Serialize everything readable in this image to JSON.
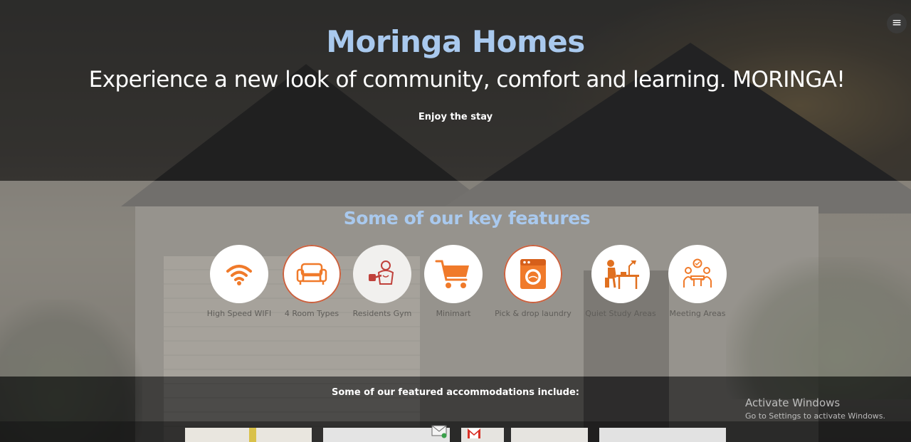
{
  "hero": {
    "title": "Moringa Homes",
    "subtitle": "Experience a new look of community, comfort and learning. MORINGA!",
    "tagline": "Enjoy the stay"
  },
  "menu": {
    "icon": "hamburger-menu-icon",
    "glyph": "≡"
  },
  "features": {
    "heading": "Some of our key features",
    "items": [
      {
        "label": "High Speed WIFI",
        "icon": "wifi-icon"
      },
      {
        "label": "4 Room Types",
        "icon": "sofa-icon"
      },
      {
        "label": "Residents Gym",
        "icon": "gym-icon"
      },
      {
        "label": "Minimart",
        "icon": "shopping-cart-icon"
      },
      {
        "label": "Pick & drop laundry",
        "icon": "washing-machine-icon"
      },
      {
        "label": "Quiet Study Areas",
        "icon": "study-desk-icon"
      },
      {
        "label": "Meeting Areas",
        "icon": "meeting-icon"
      }
    ]
  },
  "featured": {
    "heading": "Some of our featured accommodations include:"
  },
  "watermark": {
    "title": "Activate Windows",
    "subtitle": "Go to Settings to activate Windows."
  },
  "colors": {
    "accent_blue": "#a9c9ee",
    "icon_orange": "#f07a2a",
    "ring_red": "#c9613f"
  }
}
